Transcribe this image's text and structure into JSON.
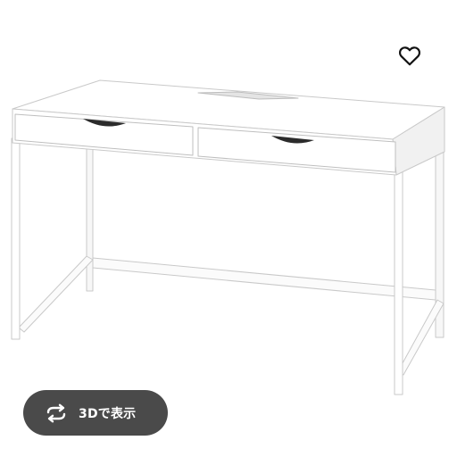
{
  "product_viewer": {
    "product": "desk-with-two-drawers",
    "colors": {
      "background": "#ffffff",
      "desk_face": "#ffffff",
      "desk_shadow": "#eaeaea",
      "desk_outline": "#c9c9c9",
      "button_bg": "#4a4a4a",
      "button_text": "#ffffff",
      "heart_stroke": "#111111"
    }
  },
  "favorite": {
    "icon": "heart-outline-icon"
  },
  "view_3d": {
    "label": "3Dで表示",
    "icon": "rotate-arrows-icon"
  }
}
